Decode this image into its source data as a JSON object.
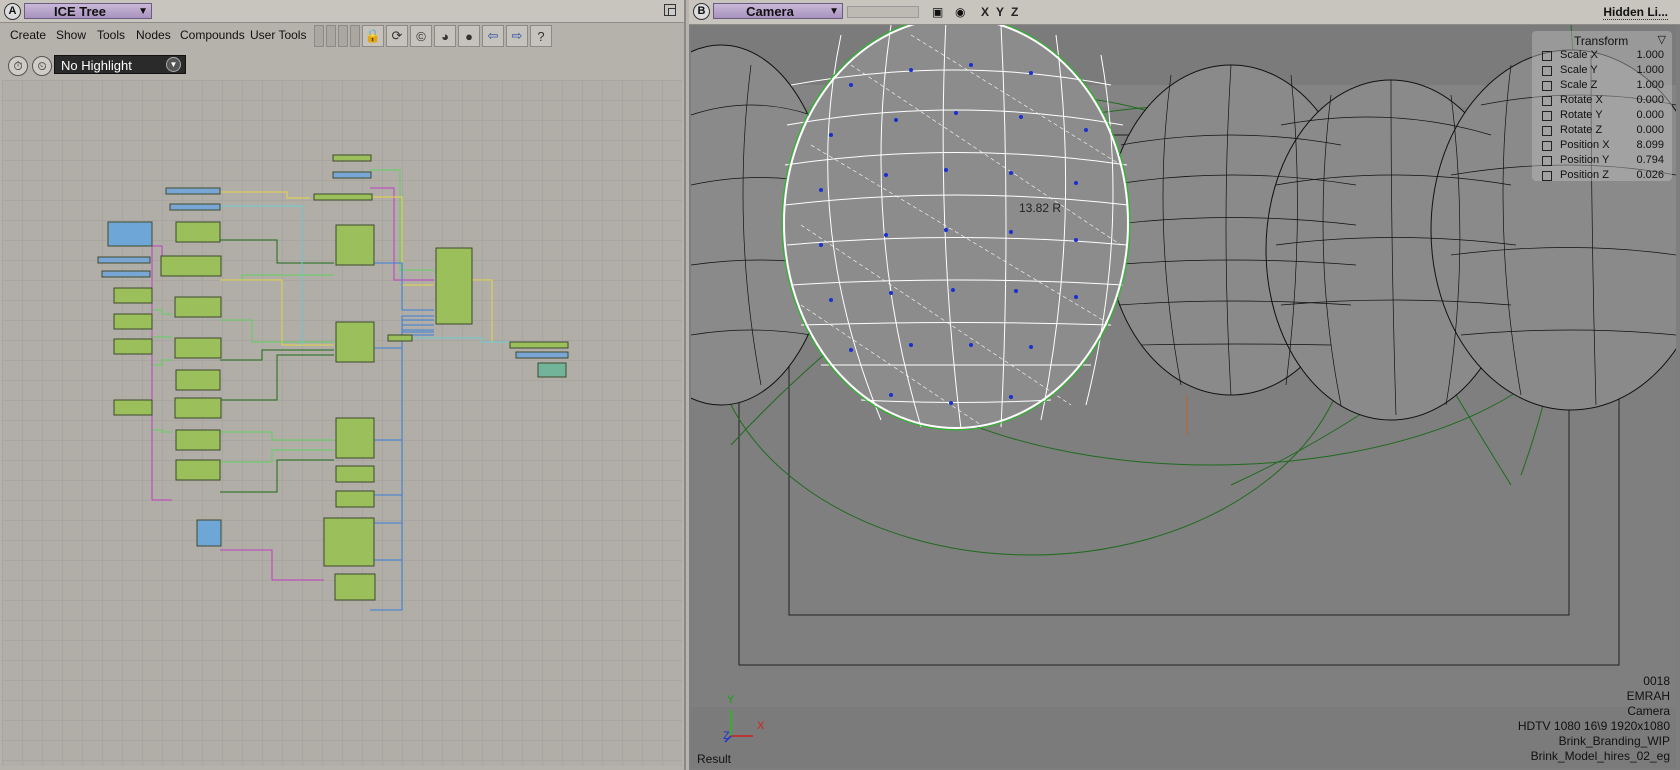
{
  "paneA": {
    "letter": "A",
    "title": "ICE Tree",
    "menu": [
      "Create",
      "Show",
      "Tools",
      "Nodes",
      "Compounds",
      "User Tools"
    ],
    "highlight": "No Highlight",
    "toolbar_icons": [
      "lock-icon",
      "refresh-icon",
      "c-icon",
      "globe-icon",
      "dot-icon",
      "arrow-left-icon",
      "arrow-right-icon",
      "help-icon"
    ]
  },
  "paneB": {
    "letter": "B",
    "title": "Camera",
    "axes": [
      "X",
      "Y",
      "Z"
    ],
    "display_mode": "Hidden Li...",
    "distance_label": "13.82 R",
    "transform": {
      "title": "Transform",
      "rows": [
        {
          "name": "Scale X",
          "value": "1.000"
        },
        {
          "name": "Scale Y",
          "value": "1.000"
        },
        {
          "name": "Scale Z",
          "value": "1.000"
        },
        {
          "name": "Rotate X",
          "value": "0.000"
        },
        {
          "name": "Rotate Y",
          "value": "0.000"
        },
        {
          "name": "Rotate Z",
          "value": "0.000"
        },
        {
          "name": "Position X",
          "value": "8.099"
        },
        {
          "name": "Position Y",
          "value": "0.794"
        },
        {
          "name": "Position Z",
          "value": "0.026"
        }
      ]
    },
    "info": {
      "frame": "0018",
      "user": "EMRAH",
      "camera": "Camera",
      "resolution": "HDTV 1080 16\\9 1920x1080",
      "project": "Brink_Branding_WIP",
      "scene": "Brink_Model_hires_02_eg"
    },
    "result": "Result",
    "gizmo": {
      "x": "X",
      "y": "Y",
      "z": "Z"
    }
  }
}
